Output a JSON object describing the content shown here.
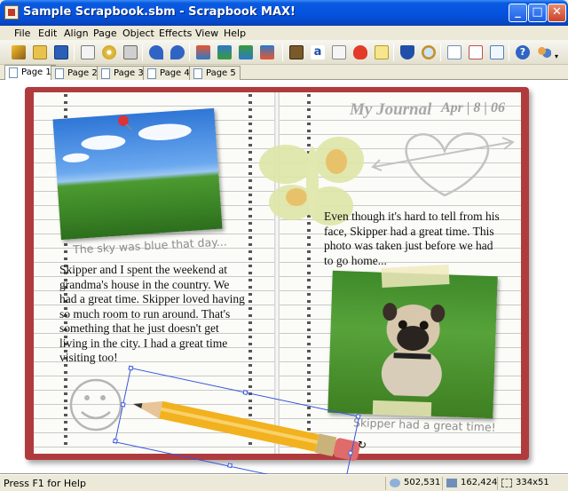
{
  "window": {
    "title": "Sample Scrapbook.sbm - Scrapbook MAX!",
    "min": "_",
    "max": "□",
    "close": "✕"
  },
  "menu": [
    "File",
    "Edit",
    "Align",
    "Page",
    "Object",
    "Effects",
    "View",
    "Help"
  ],
  "toolbar_icons": [
    "wizard-icon",
    "open-folder-icon",
    "save-icon",
    "email-icon",
    "burn-cd-icon",
    "print-icon",
    "undo-icon",
    "redo-icon",
    "bring-forward-icon",
    "send-backward-icon",
    "bring-to-front-icon",
    "send-to-back-icon",
    "add-photo-icon",
    "add-text-icon",
    "add-journal-icon",
    "add-embellishment-icon",
    "add-note-icon",
    "add-music-icon",
    "zoom-icon",
    "add-page-icon",
    "delete-page-icon",
    "page-properties-icon",
    "help-icon",
    "users-icon"
  ],
  "tabs": [
    "Page 1",
    "Page 2",
    "Page 3",
    "Page 4",
    "Page 5"
  ],
  "active_tab": 0,
  "page": {
    "left_caption": "The sky was blue that day...",
    "left_text": "Skipper and I spent the weekend at grandma's house in the country. We had a great time. Skipper loved having so much room to run around. That's something that he just doesn't get living in the city. I had a great time visiting too!",
    "journal_title": "My Journal",
    "journal_date": "Apr | 8 | 06",
    "right_text": "Even though it's hard to tell from his face, Skipper had a great time. This photo was taken just before we had to go home...",
    "right_caption": "Skipper had a great time!"
  },
  "status": {
    "help": "Press F1 for Help",
    "pos1": "502,531",
    "pos2": "162,424",
    "size": "334x51"
  },
  "colors": {
    "titlebar": "#0554e0",
    "book_cover": "#b03b3d",
    "selection": "#3355dd"
  }
}
